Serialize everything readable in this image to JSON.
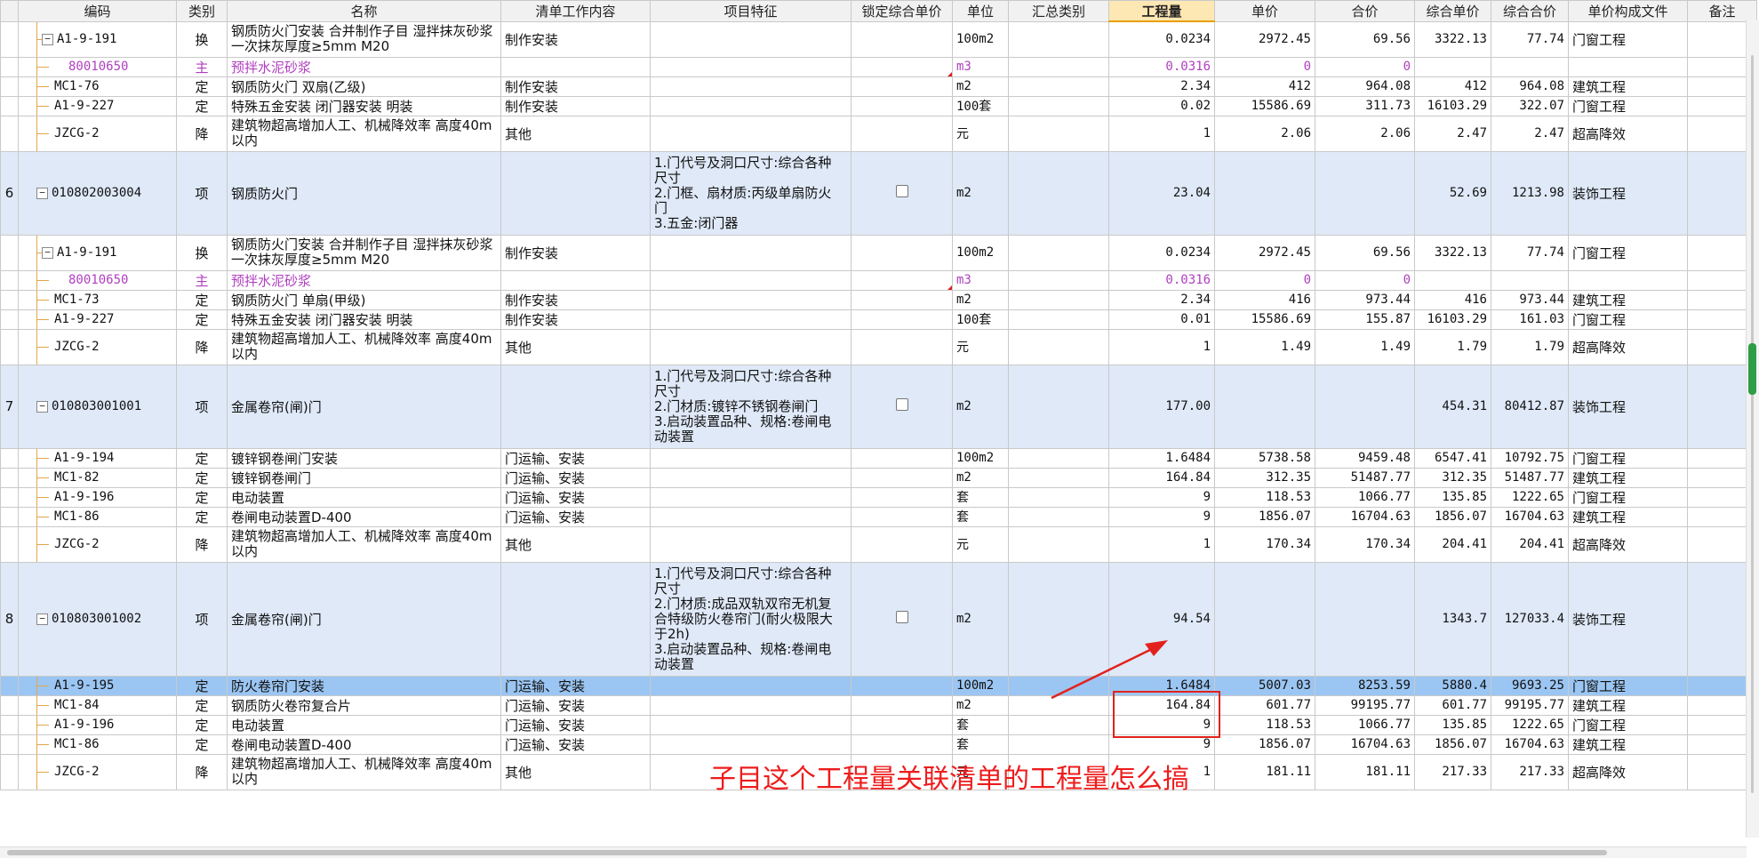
{
  "columns": {
    "idx": "",
    "code": "编码",
    "type": "类别",
    "name": "名称",
    "content": "清单工作内容",
    "feature": "项目特征",
    "lock": "锁定综合单价",
    "unit": "单位",
    "summary": "汇总类别",
    "qty": "工程量",
    "price": "单价",
    "total": "合价",
    "unit_comp": "综合单价",
    "total_comp": "综合合价",
    "file": "单价构成文件",
    "remark": "备注"
  },
  "rows": [
    {
      "code": "A1-9-191",
      "type": "换",
      "name": "钢质防火门安装  合并制作子目 湿拌抹灰砂浆 一次抹灰厚度≥5mm M20",
      "content": "制作安装",
      "unit": "100m2",
      "qty": "0.0234",
      "price": "2972.45",
      "total": "69.56",
      "unit_comp": "3322.13",
      "total_comp": "77.74",
      "file": "门窗工程"
    },
    {
      "code": "80010650",
      "type": "主",
      "name": "预拌水泥砂浆",
      "unit": "m3",
      "qty": "0.0316",
      "price": "0",
      "total": "0"
    },
    {
      "code": "MC1-76",
      "type": "定",
      "name": "钢质防火门 双扇(乙级)",
      "content": "制作安装",
      "unit": "m2",
      "qty": "2.34",
      "price": "412",
      "total": "964.08",
      "unit_comp": "412",
      "total_comp": "964.08",
      "file": "建筑工程"
    },
    {
      "code": "A1-9-227",
      "type": "定",
      "name": "特殊五金安装 闭门器安装 明装",
      "content": "制作安装",
      "unit": "100套",
      "qty": "0.02",
      "price": "15586.69",
      "total": "311.73",
      "unit_comp": "16103.29",
      "total_comp": "322.07",
      "file": "门窗工程"
    },
    {
      "code": "JZCG-2",
      "type": "降",
      "name": "建筑物超高增加人工、机械降效率 高度40m以内",
      "content": "其他",
      "unit": "元",
      "qty": "1",
      "price": "2.06",
      "total": "2.06",
      "unit_comp": "2.47",
      "total_comp": "2.47",
      "file": "超高降效"
    },
    {
      "idx": "6",
      "code": "010802003004",
      "type": "项",
      "name": "钢质防火门",
      "feature": [
        "1.门代号及洞口尺寸:综合各种",
        "尺寸",
        "2.门框、扇材质:丙级单扇防火",
        "门",
        "3.五金:闭门器"
      ],
      "unit": "m2",
      "qty": "23.04",
      "unit_comp": "52.69",
      "total_comp": "1213.98",
      "file": "装饰工程"
    },
    {
      "code": "A1-9-191",
      "type": "换",
      "name": "钢质防火门安装  合并制作子目 湿拌抹灰砂浆 一次抹灰厚度≥5mm M20",
      "content": "制作安装",
      "unit": "100m2",
      "qty": "0.0234",
      "price": "2972.45",
      "total": "69.56",
      "unit_comp": "3322.13",
      "total_comp": "77.74",
      "file": "门窗工程"
    },
    {
      "code": "80010650",
      "type": "主",
      "name": "预拌水泥砂浆",
      "unit": "m3",
      "qty": "0.0316",
      "price": "0",
      "total": "0"
    },
    {
      "code": "MC1-73",
      "type": "定",
      "name": "钢质防火门 单扇(甲级)",
      "content": "制作安装",
      "unit": "m2",
      "qty": "2.34",
      "price": "416",
      "total": "973.44",
      "unit_comp": "416",
      "total_comp": "973.44",
      "file": "建筑工程"
    },
    {
      "code": "A1-9-227",
      "type": "定",
      "name": "特殊五金安装 闭门器安装 明装",
      "content": "制作安装",
      "unit": "100套",
      "qty": "0.01",
      "price": "15586.69",
      "total": "155.87",
      "unit_comp": "16103.29",
      "total_comp": "161.03",
      "file": "门窗工程"
    },
    {
      "code": "JZCG-2",
      "type": "降",
      "name": "建筑物超高增加人工、机械降效率 高度40m以内",
      "content": "其他",
      "unit": "元",
      "qty": "1",
      "price": "1.49",
      "total": "1.49",
      "unit_comp": "1.79",
      "total_comp": "1.79",
      "file": "超高降效"
    },
    {
      "idx": "7",
      "code": "010803001001",
      "type": "项",
      "name": "金属卷帘(闸)门",
      "feature": [
        "1.门代号及洞口尺寸:综合各种",
        "尺寸",
        "2.门材质:镀锌不锈钢卷闸门",
        "3.启动装置品种、规格:卷闸电",
        "动装置"
      ],
      "unit": "m2",
      "qty": "177.00",
      "unit_comp": "454.31",
      "total_comp": "80412.87",
      "file": "装饰工程"
    },
    {
      "code": "A1-9-194",
      "type": "定",
      "name": "镀锌钢卷闸门安装",
      "content": "门运输、安装",
      "unit": "100m2",
      "qty": "1.6484",
      "price": "5738.58",
      "total": "9459.48",
      "unit_comp": "6547.41",
      "total_comp": "10792.75",
      "file": "门窗工程"
    },
    {
      "code": "MC1-82",
      "type": "定",
      "name": "镀锌钢卷闸门",
      "content": "门运输、安装",
      "unit": "m2",
      "qty": "164.84",
      "price": "312.35",
      "total": "51487.77",
      "unit_comp": "312.35",
      "total_comp": "51487.77",
      "file": "建筑工程"
    },
    {
      "code": "A1-9-196",
      "type": "定",
      "name": "电动装置",
      "content": "门运输、安装",
      "unit": "套",
      "qty": "9",
      "price": "118.53",
      "total": "1066.77",
      "unit_comp": "135.85",
      "total_comp": "1222.65",
      "file": "门窗工程"
    },
    {
      "code": "MC1-86",
      "type": "定",
      "name": "卷闸电动装置D-400",
      "content": "门运输、安装",
      "unit": "套",
      "qty": "9",
      "price": "1856.07",
      "total": "16704.63",
      "unit_comp": "1856.07",
      "total_comp": "16704.63",
      "file": "建筑工程"
    },
    {
      "code": "JZCG-2",
      "type": "降",
      "name": "建筑物超高增加人工、机械降效率 高度40m以内",
      "content": "其他",
      "unit": "元",
      "qty": "1",
      "price": "170.34",
      "total": "170.34",
      "unit_comp": "204.41",
      "total_comp": "204.41",
      "file": "超高降效"
    },
    {
      "idx": "8",
      "code": "010803001002",
      "type": "项",
      "name": "金属卷帘(闸)门",
      "feature": [
        "1.门代号及洞口尺寸:综合各种",
        "尺寸",
        "2.门材质:成品双轨双帘无机复",
        "合特级防火卷帘门(耐火极限大",
        "于2h)",
        "3.启动装置品种、规格:卷闸电",
        "动装置"
      ],
      "unit": "m2",
      "qty": "94.54",
      "unit_comp": "1343.7",
      "total_comp": "127033.4",
      "file": "装饰工程"
    },
    {
      "code": "A1-9-195",
      "type": "定",
      "name": "防火卷帘门安装",
      "content": "门运输、安装",
      "unit": "100m2",
      "qty": "1.6484",
      "price": "5007.03",
      "total": "8253.59",
      "unit_comp": "5880.4",
      "total_comp": "9693.25",
      "file": "门窗工程"
    },
    {
      "code": "MC1-84",
      "type": "定",
      "name": "钢质防火卷帘复合片",
      "content": "门运输、安装",
      "unit": "m2",
      "qty": "164.84",
      "price": "601.77",
      "total": "99195.77",
      "unit_comp": "601.77",
      "total_comp": "99195.77",
      "file": "建筑工程"
    },
    {
      "code": "A1-9-196",
      "type": "定",
      "name": "电动装置",
      "content": "门运输、安装",
      "unit": "套",
      "qty": "9",
      "price": "118.53",
      "total": "1066.77",
      "unit_comp": "135.85",
      "total_comp": "1222.65",
      "file": "门窗工程"
    },
    {
      "code": "MC1-86",
      "type": "定",
      "name": "卷闸电动装置D-400",
      "content": "门运输、安装",
      "unit": "套",
      "qty": "9",
      "price": "1856.07",
      "total": "16704.63",
      "unit_comp": "1856.07",
      "total_comp": "16704.63",
      "file": "建筑工程"
    },
    {
      "code": "JZCG-2",
      "type": "降",
      "name": "建筑物超高增加人工、机械降效率 高度40m以内",
      "content": "其他",
      "unit": "元",
      "qty": "1",
      "price": "181.11",
      "total": "181.11",
      "unit_comp": "217.33",
      "total_comp": "217.33",
      "file": "超高降效"
    }
  ],
  "annotation": {
    "text": "子目这个工程量关联清单的工程量怎么搞",
    "color": "#ee1c1c"
  },
  "colors": {
    "header_bg": "#f1f1f1",
    "bill_row_bg": "#dfe9f8",
    "selected_row_bg": "#9bc6f3",
    "main_material_text": "#b040c0",
    "tree_line": "#e2a64a",
    "scroll_thumb": "#2f9d46"
  },
  "icons": {
    "expand": "minus-box-icon",
    "lock": "checkbox-icon"
  }
}
